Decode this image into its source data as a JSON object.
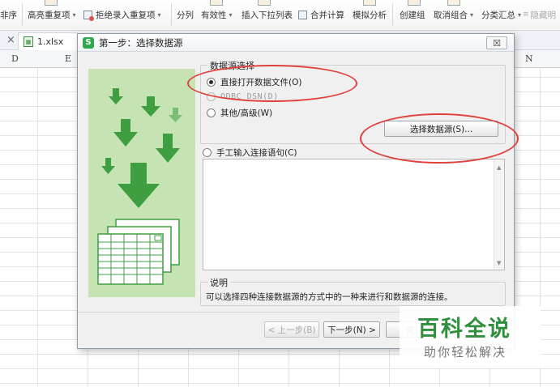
{
  "ribbon": {
    "items": [
      {
        "label": "非序",
        "caret": false
      },
      {
        "label": "高亮重复项",
        "caret": true
      },
      {
        "label": "拒绝录入重复项",
        "caret": true
      },
      {
        "label": "分列",
        "caret": false
      },
      {
        "label": "有效性",
        "caret": true
      },
      {
        "label": "插入下拉列表",
        "caret": false
      },
      {
        "label": "合并计算",
        "caret": false
      },
      {
        "label": "模拟分析",
        "caret": false
      },
      {
        "label": "创建组",
        "caret": false
      },
      {
        "label": "取消组合",
        "caret": true
      },
      {
        "label": "分类汇总",
        "caret": true
      },
      {
        "label": "隐藏明",
        "caret": false
      }
    ]
  },
  "tabs": {
    "close_glyph": "×",
    "file_name": "1.xlsx"
  },
  "sheet": {
    "columns": [
      "D",
      "E",
      "N"
    ]
  },
  "dialog": {
    "title": "第一步：选择数据源",
    "close_label": "☒",
    "data_source_group": {
      "legend": "数据源选择",
      "options": [
        {
          "label": "直接打开数据文件(O)",
          "selected": true,
          "enabled": true
        },
        {
          "label": "ODBC DSN(D)",
          "selected": false,
          "enabled": false
        },
        {
          "label": "其他/高级(W)",
          "selected": false,
          "enabled": true
        }
      ],
      "select_button": "选择数据源(S)..."
    },
    "manual_option": {
      "label": "手工输入连接语句(C)",
      "selected": false
    },
    "description": {
      "legend": "说明",
      "text": "可以选择四种连接数据源的方式中的一种来进行和数据源的连接。"
    },
    "footer": {
      "prev_button": "< 上一步(B)",
      "next_button": "下一步(N) >",
      "finish_button": "完"
    }
  },
  "watermark": {
    "main": "百科全说",
    "sub": "助你轻松解决"
  },
  "colors": {
    "accent_green": "#2fa84f",
    "illustration_bg": "#c5e3b3",
    "arrow_green": "#3f9e3f",
    "annotation_red": "#e0413c"
  }
}
